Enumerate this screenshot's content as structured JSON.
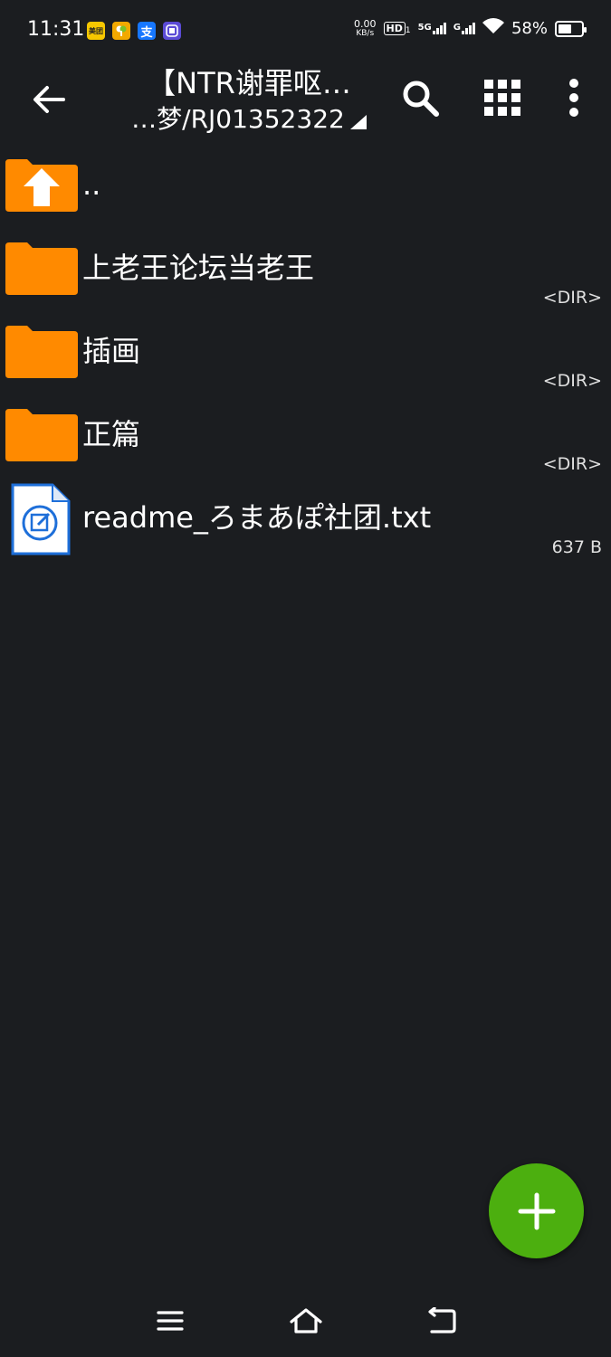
{
  "status_bar": {
    "time": "11:31",
    "net_speed_value": "0.00",
    "net_speed_unit": "KB/s",
    "hd": "HD",
    "hd_sub": "1",
    "signal1": "5G",
    "signal2": "G",
    "battery": "58%",
    "battery_level": 0.58,
    "app_icons": [
      {
        "name": "meituan-icon",
        "label": "美团",
        "color": "#f6c700"
      },
      {
        "name": "sprout-app-icon",
        "label": "",
        "color": "#f2a900"
      },
      {
        "name": "alipay-icon",
        "label": "支",
        "color": "#1677ff"
      },
      {
        "name": "app-badge-icon",
        "label": "",
        "color": "#5b4bd6"
      }
    ]
  },
  "toolbar": {
    "title": "【NTR谢罪呕…",
    "subtitle": "…梦/RJ01352322",
    "icons": [
      "back-arrow-icon",
      "search-icon",
      "grid-view-icon",
      "more-vert-icon"
    ]
  },
  "files": [
    {
      "name": "..",
      "meta": "",
      "type": "parent"
    },
    {
      "name": "上老王论坛当老王",
      "meta": "<DIR>",
      "type": "folder"
    },
    {
      "name": "插画",
      "meta": "<DIR>",
      "type": "folder"
    },
    {
      "name": "正篇",
      "meta": "<DIR>",
      "type": "folder"
    },
    {
      "name": "readme_ろまあぽ社团.txt",
      "meta": "637 B",
      "type": "text"
    }
  ],
  "colors": {
    "background": "#1b1d20",
    "folder": "#ff8a00",
    "fab": "#4caf0f",
    "text_file": "#1e6fd9"
  }
}
